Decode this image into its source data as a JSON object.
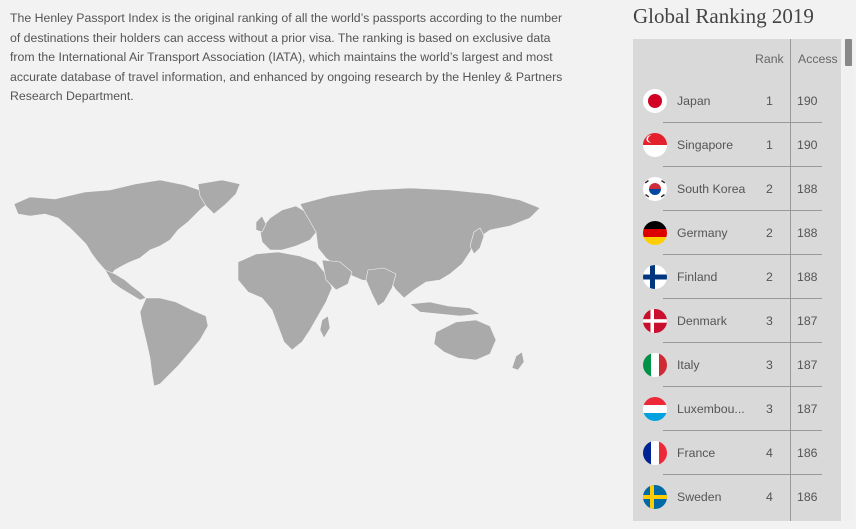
{
  "intro": {
    "text": "The Henley Passport Index is the original ranking of all the world’s passports according to the number of destinations their holders can access without a prior visa. The ranking is based on exclusive data from the International Air Transport Association (IATA), which maintains the world’s largest and most accurate database of travel information, and enhanced by ongoing research by the Henley & Partners Research Department."
  },
  "ranking": {
    "title": "Global Ranking 2019",
    "header": {
      "rank": "Rank",
      "access": "Access"
    },
    "rows": [
      {
        "country": "Japan",
        "rank": "1",
        "access": "190",
        "flag": "japan-flag"
      },
      {
        "country": "Singapore",
        "rank": "1",
        "access": "190",
        "flag": "singapore-flag"
      },
      {
        "country": "South Korea",
        "rank": "2",
        "access": "188",
        "flag": "south-korea-flag"
      },
      {
        "country": "Germany",
        "rank": "2",
        "access": "188",
        "flag": "germany-flag"
      },
      {
        "country": "Finland",
        "rank": "2",
        "access": "188",
        "flag": "finland-flag"
      },
      {
        "country": "Denmark",
        "rank": "3",
        "access": "187",
        "flag": "denmark-flag"
      },
      {
        "country": "Italy",
        "rank": "3",
        "access": "187",
        "flag": "italy-flag"
      },
      {
        "country": "Luxembou...",
        "rank": "3",
        "access": "187",
        "flag": "luxembourg-flag"
      },
      {
        "country": "France",
        "rank": "4",
        "access": "186",
        "flag": "france-flag"
      },
      {
        "country": "Sweden",
        "rank": "4",
        "access": "186",
        "flag": "sweden-flag"
      }
    ]
  },
  "colors": {
    "map_land": "#aaaaaa",
    "table_bg": "#d9d9d9",
    "page_bg": "#f2f2f2"
  }
}
